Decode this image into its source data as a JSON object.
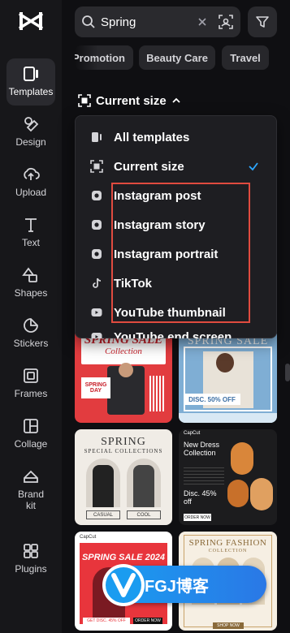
{
  "sidebar": {
    "items": [
      {
        "label": "Templates",
        "icon": "templates-icon",
        "active": true
      },
      {
        "label": "Design",
        "icon": "design-icon"
      },
      {
        "label": "Upload",
        "icon": "upload-icon"
      },
      {
        "label": "Text",
        "icon": "text-icon"
      },
      {
        "label": "Shapes",
        "icon": "shapes-icon"
      },
      {
        "label": "Stickers",
        "icon": "stickers-icon"
      },
      {
        "label": "Frames",
        "icon": "frames-icon"
      },
      {
        "label": "Collage",
        "icon": "collage-icon"
      },
      {
        "label": "Brand kit",
        "icon": "brand-kit-icon"
      },
      {
        "label": "Plugins",
        "icon": "plugins-icon"
      }
    ]
  },
  "search": {
    "value": "Spring"
  },
  "chips": [
    "Promotion",
    "Beauty Care",
    "Travel"
  ],
  "size_filter": {
    "label": "Current size"
  },
  "dropdown": {
    "options": [
      {
        "label": "All templates",
        "icon": "phone-icon"
      },
      {
        "label": "Current size",
        "icon": "resize-icon",
        "selected": true
      },
      {
        "label": "Instagram post",
        "icon": "instagram-icon"
      },
      {
        "label": "Instagram story",
        "icon": "instagram-icon"
      },
      {
        "label": "Instagram portrait",
        "icon": "instagram-icon"
      },
      {
        "label": "TikTok",
        "icon": "tiktok-icon"
      },
      {
        "label": "YouTube thumbnail",
        "icon": "youtube-icon"
      },
      {
        "label": "YouTube end screen",
        "icon": "youtube-icon"
      }
    ]
  },
  "templates": [
    {
      "title": "SPRING SALE",
      "subtitle": "Collection",
      "footer": "SPRING DAY",
      "theme": "red"
    },
    {
      "title": "SPRING SALE",
      "subtitle": "DISC. 50% OFF",
      "theme": "blue"
    },
    {
      "title": "SPRING",
      "subtitle": "SPECIAL COLLECTIONS",
      "button1": "CASUAL",
      "button2": "COOL",
      "theme": "beige"
    },
    {
      "title": "New Dress Collection",
      "subtitle": "Disc. 45% off",
      "button": "ORDER NOW",
      "brand": "CapCut",
      "theme": "dark"
    },
    {
      "title": "SPRING SALE 2024",
      "subtitle": "GET DISC. 45% OFF",
      "button": "ORDER NOW",
      "brand": "CapCut",
      "theme": "red"
    },
    {
      "title": "SPRING FASHION",
      "subtitle": "COLLECTION",
      "button": "SHOP NOW",
      "theme": "cream"
    }
  ],
  "watermark": {
    "text": "FGJ博客"
  },
  "colors": {
    "accent": "#1a9cf0",
    "highlight": "#e04b3f",
    "check": "#2da8ff"
  }
}
